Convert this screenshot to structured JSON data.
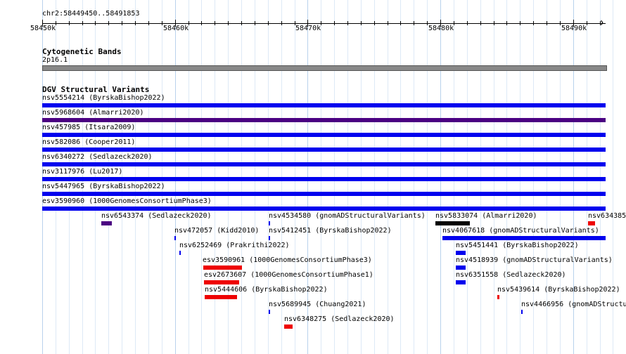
{
  "colors": {
    "grid_minor": "#dde9f6",
    "grid_major": "#b9d2ec",
    "blue": "#0000ee",
    "purple": "#4b0082",
    "red": "#ee0000",
    "black": "#000000",
    "band_gray": "#888888"
  },
  "ruler": {
    "range_label": "chr2:58449450..58491853",
    "ticks": [
      "58450k",
      "58460k",
      "58470k",
      "58480k",
      "58490k"
    ]
  },
  "cytoband": {
    "title": "Cytogenetic Bands",
    "band_label": "2p16.1"
  },
  "dgv": {
    "title": "DGV Structural Variants",
    "tracks": [
      {
        "label": "nsv5554214 (ByrskaBishop2022)",
        "color": "blue"
      },
      {
        "label": "nsv5968604 (Almarri2020)",
        "color": "purple"
      },
      {
        "label": "nsv457985 (Itsara2009)",
        "color": "blue"
      },
      {
        "label": "nsv582086 (Cooper2011)",
        "color": "blue"
      },
      {
        "label": "nsv6340272 (Sedlazeck2020)",
        "color": "blue"
      },
      {
        "label": "nsv3117976 (Lu2017)",
        "color": "blue"
      },
      {
        "label": "nsv5447965 (ByrskaBishop2022)",
        "color": "blue"
      },
      {
        "label": "esv3590960 (1000GenomesConsortiumPhase3)",
        "color": "blue"
      }
    ],
    "features": [
      {
        "label": "nsv6543374 (Sedlazeck2020)",
        "color": "purple"
      },
      {
        "label": "nsv4534580 (gnomADStructuralVariants)",
        "color": "blue"
      },
      {
        "label": "nsv5833074 (Almarri2020)",
        "color": "black"
      },
      {
        "label": "nsv634385",
        "color": "red"
      },
      {
        "label": "nsv472057 (Kidd2010)",
        "color": "blue"
      },
      {
        "label": "nsv5412451 (ByrskaBishop2022)",
        "color": "blue"
      },
      {
        "label": "nsv4067618 (gnomADStructuralVariants)",
        "color": "blue"
      },
      {
        "label": "nsv6252469 (Prakrithi2022)",
        "color": "blue"
      },
      {
        "label": "nsv5451441 (ByrskaBishop2022)",
        "color": "blue"
      },
      {
        "label": "esv3590961 (1000GenomesConsortiumPhase3)",
        "color": "red"
      },
      {
        "label": "nsv4518939 (gnomADStructuralVariants)",
        "color": "blue"
      },
      {
        "label": "esv2673607 (1000GenomesConsortiumPhase1)",
        "color": "red"
      },
      {
        "label": "nsv6351558 (Sedlazeck2020)",
        "color": "blue"
      },
      {
        "label": "nsv5444606 (ByrskaBishop2022)",
        "color": "red"
      },
      {
        "label": "nsv5439614 (ByrskaBishop2022)",
        "color": "red"
      },
      {
        "label": "nsv5689945 (Chuang2021)",
        "color": "blue"
      },
      {
        "label": "nsv4466956 (gnomADStructu",
        "color": "blue"
      },
      {
        "label": "nsv6348275 (Sedlazeck2020)",
        "color": "red"
      }
    ]
  }
}
